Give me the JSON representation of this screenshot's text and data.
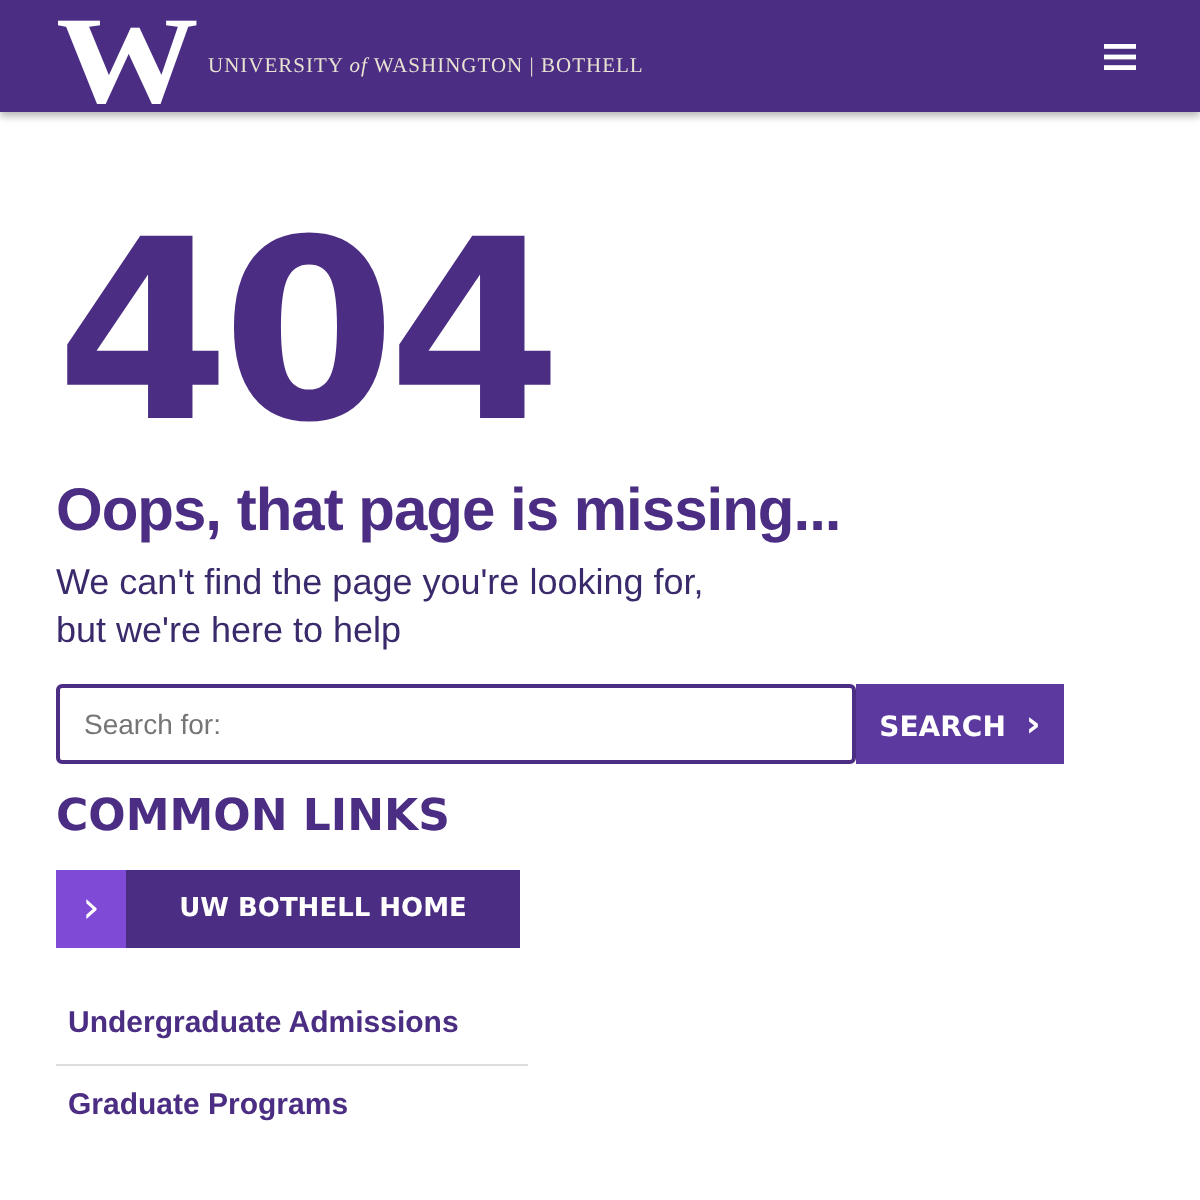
{
  "header": {
    "logo_letter": "W",
    "wordmark": "UNIVERSITY *of* WASHINGTON | BOTHELL"
  },
  "error": {
    "code": "404",
    "title": "Oops, that page is missing...",
    "message": "We can't find the page you're looking for, but we're here to help"
  },
  "search": {
    "placeholder": "Search for:",
    "button": "SEARCH",
    "button_icon": "›"
  },
  "common_links": {
    "title": "COMMON LINKS",
    "home_button": {
      "icon": "›",
      "label": "UW BOTHELL HOME"
    },
    "links": [
      "Undergraduate Admissions",
      "Graduate Programs"
    ]
  }
}
